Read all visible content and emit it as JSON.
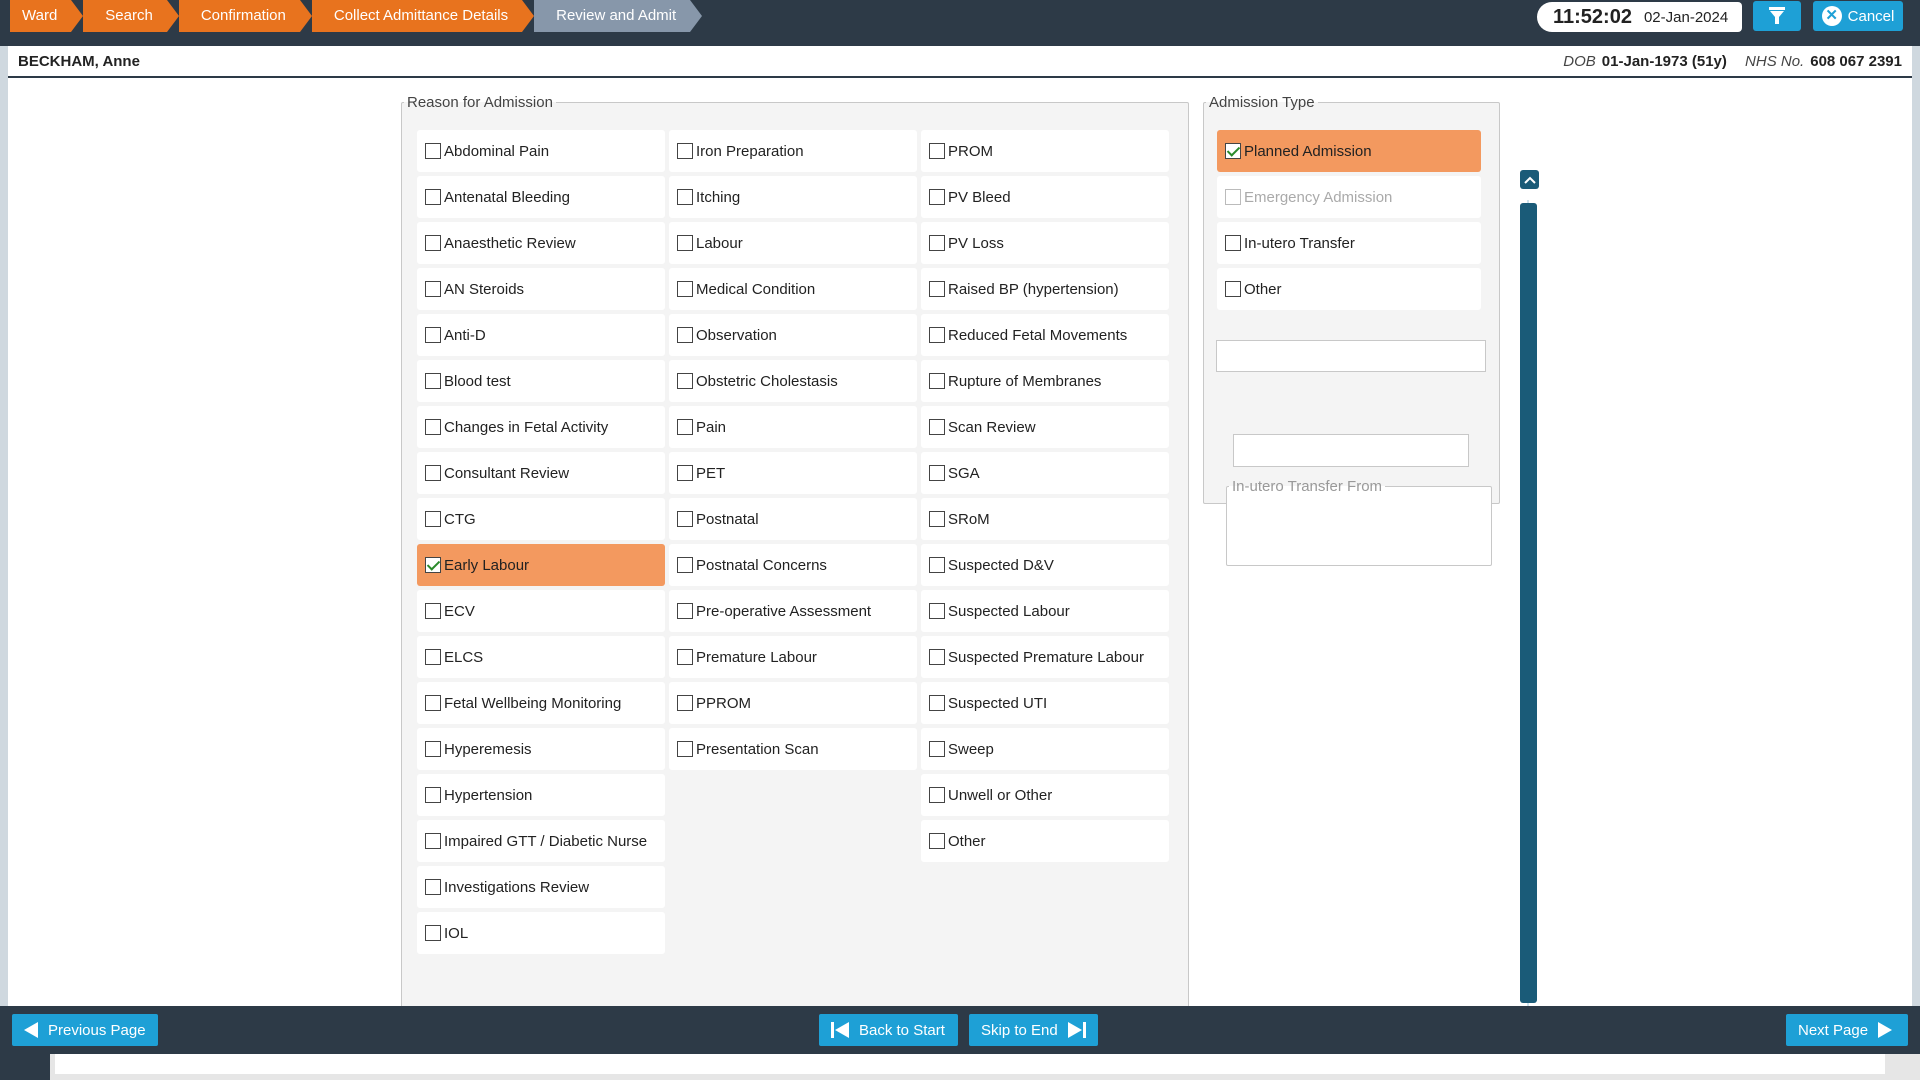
{
  "breadcrumb": [
    "Ward",
    "Search",
    "Confirmation",
    "Collect Admittance Details",
    "Review and Admit"
  ],
  "header": {
    "time": "11:52:02",
    "date": "02-Jan-2024",
    "filter_icon": "funnel-icon",
    "cancel_label": "Cancel"
  },
  "patient": {
    "name": "BECKHAM, Anne",
    "dob_label": "DOB",
    "dob": "01-Jan-1973 (51y)",
    "nhs_label": "NHS No.",
    "nhs": "608 067 2391"
  },
  "reason": {
    "legend": "Reason for Admission",
    "col1": [
      {
        "label": "Abdominal Pain",
        "checked": false
      },
      {
        "label": "Antenatal Bleeding",
        "checked": false
      },
      {
        "label": "Anaesthetic Review",
        "checked": false
      },
      {
        "label": "AN Steroids",
        "checked": false
      },
      {
        "label": "Anti-D",
        "checked": false
      },
      {
        "label": "Blood test",
        "checked": false
      },
      {
        "label": "Changes in Fetal Activity",
        "checked": false
      },
      {
        "label": "Consultant Review",
        "checked": false
      },
      {
        "label": "CTG",
        "checked": false
      },
      {
        "label": "Early Labour",
        "checked": true
      },
      {
        "label": "ECV",
        "checked": false
      },
      {
        "label": "ELCS",
        "checked": false
      },
      {
        "label": "Fetal Wellbeing Monitoring",
        "checked": false
      },
      {
        "label": "Hyperemesis",
        "checked": false
      },
      {
        "label": "Hypertension",
        "checked": false
      },
      {
        "label": "Impaired GTT / Diabetic Nurse",
        "checked": false
      },
      {
        "label": "Investigations Review",
        "checked": false
      },
      {
        "label": "IOL",
        "checked": false
      }
    ],
    "col2": [
      {
        "label": "Iron Preparation",
        "checked": false
      },
      {
        "label": "Itching",
        "checked": false
      },
      {
        "label": "Labour",
        "checked": false
      },
      {
        "label": "Medical Condition",
        "checked": false
      },
      {
        "label": "Observation",
        "checked": false
      },
      {
        "label": "Obstetric Cholestasis",
        "checked": false
      },
      {
        "label": "Pain",
        "checked": false
      },
      {
        "label": "PET",
        "checked": false
      },
      {
        "label": "Postnatal",
        "checked": false
      },
      {
        "label": "Postnatal Concerns",
        "checked": false
      },
      {
        "label": "Pre-operative Assessment",
        "checked": false
      },
      {
        "label": "Premature Labour",
        "checked": false
      },
      {
        "label": "PPROM",
        "checked": false
      },
      {
        "label": "Presentation Scan",
        "checked": false
      }
    ],
    "col3": [
      {
        "label": "PROM",
        "checked": false
      },
      {
        "label": "PV Bleed",
        "checked": false
      },
      {
        "label": "PV Loss",
        "checked": false
      },
      {
        "label": "Raised BP (hypertension)",
        "checked": false
      },
      {
        "label": "Reduced Fetal Movements",
        "checked": false
      },
      {
        "label": "Rupture of Membranes",
        "checked": false
      },
      {
        "label": "Scan Review",
        "checked": false
      },
      {
        "label": "SGA",
        "checked": false
      },
      {
        "label": "SRoM",
        "checked": false
      },
      {
        "label": "Suspected D&V",
        "checked": false
      },
      {
        "label": "Suspected Labour",
        "checked": false
      },
      {
        "label": "Suspected Premature Labour",
        "checked": false
      },
      {
        "label": "Suspected UTI",
        "checked": false
      },
      {
        "label": "Sweep",
        "checked": false
      },
      {
        "label": "Unwell or Other",
        "checked": false
      },
      {
        "label": "Other",
        "checked": false
      }
    ]
  },
  "admission_type": {
    "legend": "Admission Type",
    "options": [
      {
        "label": "Planned Admission",
        "checked": true,
        "disabled": false
      },
      {
        "label": "Emergency Admission",
        "checked": false,
        "disabled": true
      },
      {
        "label": "In-utero Transfer",
        "checked": false,
        "disabled": false
      },
      {
        "label": "Other",
        "checked": false,
        "disabled": false
      }
    ],
    "other_text": "",
    "transfer_from_legend": "In-utero Transfer From",
    "transfer_from_value": ""
  },
  "footer": {
    "previous": "Previous Page",
    "back_to_start": "Back to Start",
    "skip_to_end": "Skip to End",
    "next": "Next Page"
  },
  "colors": {
    "accent_orange": "#e8731e",
    "selected_fill": "#f3995f",
    "button_blue": "#1ea0d6",
    "bar_dark": "#2d3a47",
    "scroll_blue": "#1a5b78"
  }
}
